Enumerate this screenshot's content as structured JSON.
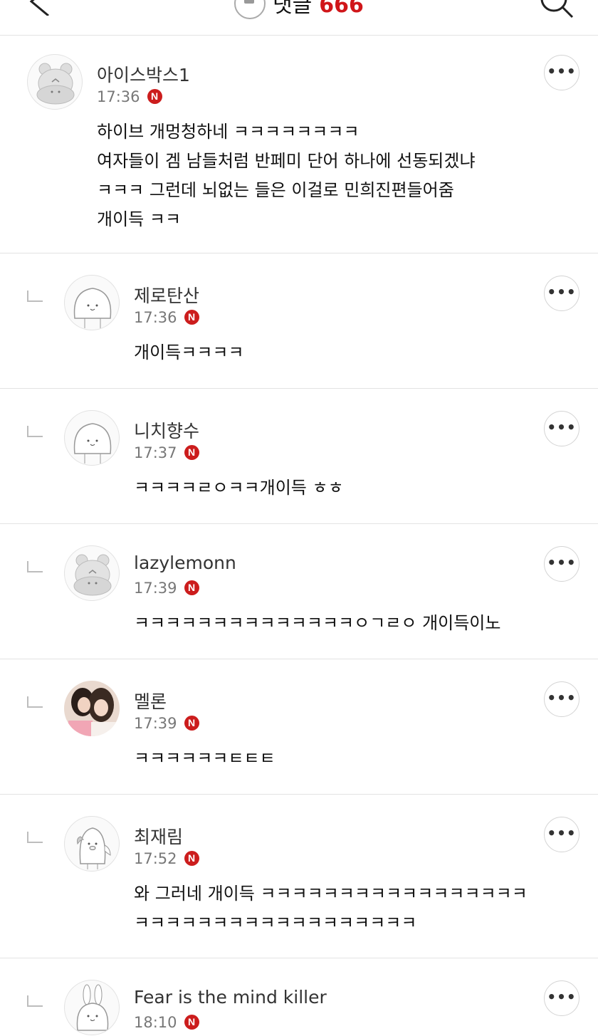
{
  "header": {
    "title": "댓글",
    "count": "666",
    "back_icon": "chevron-left-icon",
    "bell_icon": "bell-icon",
    "search_icon": "search-icon",
    "count_color": "#d0161a"
  },
  "comments": [
    {
      "name": "아이스박스1",
      "time": "17:36",
      "badge": "N",
      "text": "하이브 개멍청하네 ㅋㅋㅋㅋㅋㅋㅋㅋ\n여자들이 겜    남들처럼 반페미 단어 하나에 선동되겠냐\nㅋㅋㅋ 그런데 뇌없는        들은 이걸로 민희진편들어줌\n개이득 ㅋㅋ",
      "avatar": "hippo-avatar",
      "reply": false
    },
    {
      "name": "제로탄산",
      "time": "17:36",
      "badge": "N",
      "text": "개이득ㅋㅋㅋㅋ",
      "avatar": "dumpling-avatar",
      "reply": true
    },
    {
      "name": "니치향수",
      "time": "17:37",
      "badge": "N",
      "text": "ㅋㅋㅋㅋㄹㅇㅋㅋ개이득 ㅎㅎ",
      "avatar": "dumpling-avatar",
      "reply": true
    },
    {
      "name": "lazylemonn",
      "time": "17:39",
      "badge": "N",
      "text": "ㅋㅋㅋㅋㅋㅋㅋㅋㅋㅋㅋㅋㅋㅋㅇㄱㄹㅇ 개이득이노",
      "avatar": "hippo-avatar",
      "reply": true
    },
    {
      "name": "멜론",
      "time": "17:39",
      "badge": "N",
      "text": "ㅋㅋㅋㅋㅋㅋㅌㅌㅌ",
      "avatar": "photo-avatar",
      "reply": true
    },
    {
      "name": "최재림",
      "time": "17:52",
      "badge": "N",
      "text": "와 그러네 개이득 ㅋㅋㅋㅋㅋㅋㅋㅋㅋㅋㅋㅋㅋㅋㅋㅋㅋ\nㅋㅋㅋㅋㅋㅋㅋㅋㅋㅋㅋㅋㅋㅋㅋㅋㅋㅋ",
      "avatar": "penguin-avatar",
      "reply": true
    },
    {
      "name": "Fear is the mind killer",
      "time": "18:10",
      "badge": "N",
      "text": "",
      "avatar": "bunny-avatar",
      "reply": true
    }
  ],
  "more_label": "•••",
  "colors": {
    "badge": "#cc1d1d",
    "divider": "#e3e3e3"
  }
}
